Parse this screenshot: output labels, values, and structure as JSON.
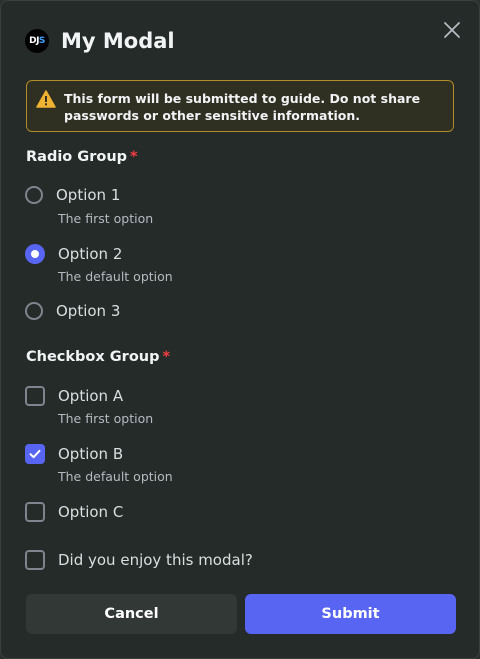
{
  "modal": {
    "title": "My Modal",
    "app_icon": {
      "part1": "DJ",
      "part2": "S"
    },
    "warning": "This form will be submitted to guide. Do not share passwords or other sensitive information."
  },
  "radio_group": {
    "label": "Radio Group",
    "required_mark": "*",
    "options": [
      {
        "label": "Option 1",
        "description": "The first option",
        "checked": false
      },
      {
        "label": "Option 2",
        "description": "The default option",
        "checked": true
      },
      {
        "label": "Option 3",
        "description": "",
        "checked": false
      }
    ]
  },
  "checkbox_group": {
    "label": "Checkbox Group",
    "required_mark": "*",
    "options": [
      {
        "label": "Option A",
        "description": "The first option",
        "checked": false
      },
      {
        "label": "Option B",
        "description": "The default option",
        "checked": true
      },
      {
        "label": "Option C",
        "description": "",
        "checked": false
      }
    ]
  },
  "enjoy_checkbox": {
    "label": "Did you enjoy this modal?",
    "checked": false
  },
  "buttons": {
    "cancel": "Cancel",
    "submit": "Submit"
  },
  "colors": {
    "accent": "#5865f2",
    "required": "#f23f43",
    "warning_border": "#b28b2a",
    "warning_icon": "#f0b232"
  },
  "icons": {
    "close": "close-icon",
    "warning": "warning-icon",
    "check": "check-icon"
  }
}
